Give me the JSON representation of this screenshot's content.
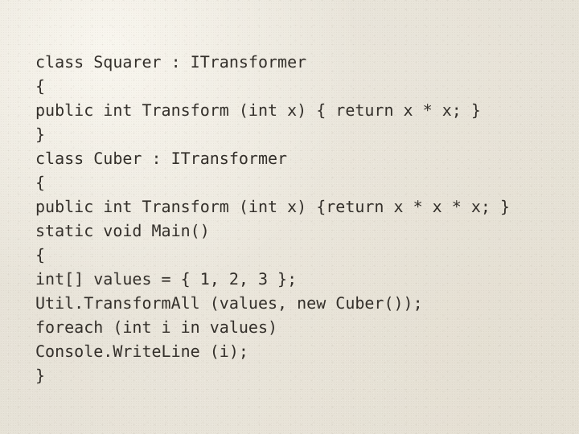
{
  "page": {
    "kind": "code-listing-scan",
    "language": "C#",
    "background_color": "#e9e5db",
    "text_color": "#332f2a"
  },
  "code": {
    "lines": [
      "class Squarer : ITransformer",
      "{",
      "public int Transform (int x) { return x * x; }",
      "}",
      "class Cuber : ITransformer",
      "{",
      "public int Transform (int x) {return x * x * x; }",
      "static void Main()",
      "{",
      "int[] values = { 1, 2, 3 };",
      "Util.TransformAll (values, new Cuber());",
      "foreach (int i in values)",
      "Console.WriteLine (i);",
      "}"
    ]
  }
}
